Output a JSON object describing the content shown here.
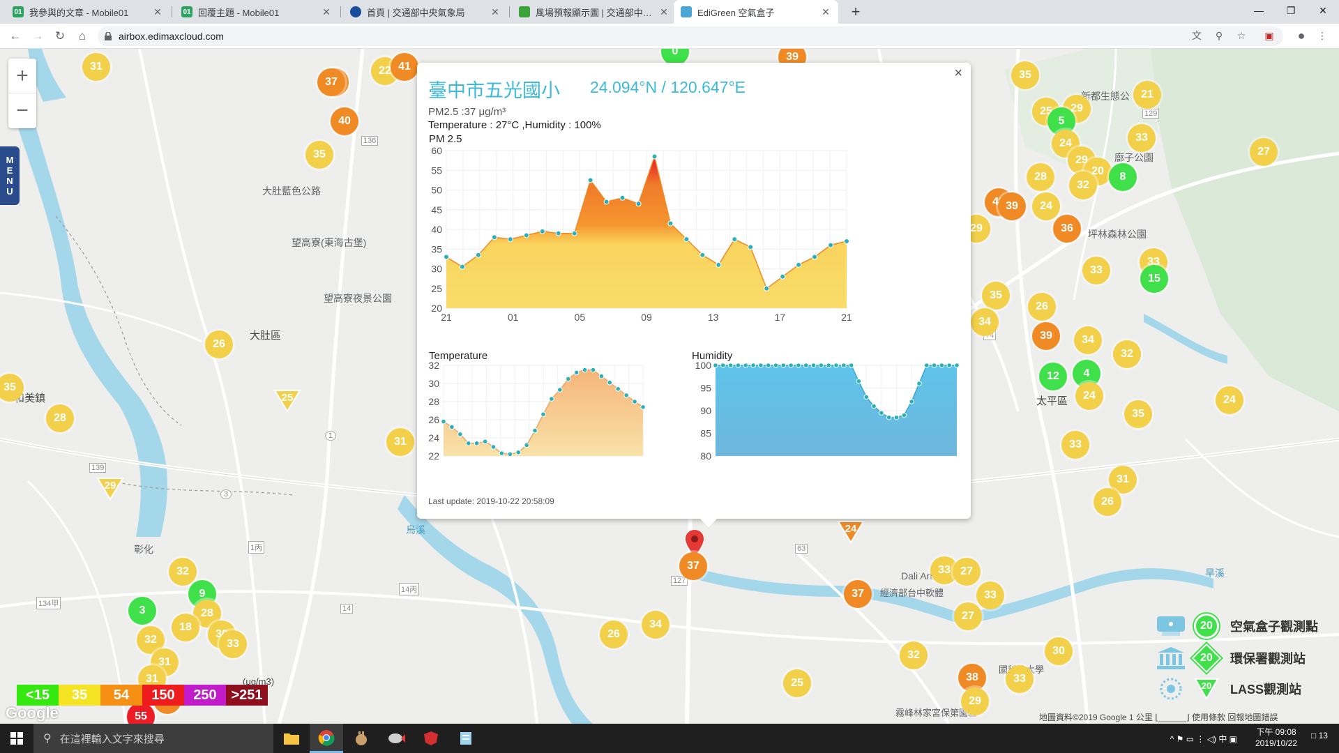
{
  "browser": {
    "tabs": [
      {
        "label": "我參與的文章 - Mobile01",
        "icon_color": "#2aa35f",
        "active": false
      },
      {
        "label": "回覆主題 - Mobile01",
        "icon_color": "#2aa35f",
        "active": false
      },
      {
        "label": "首頁 | 交通部中央氣象局",
        "icon_color": "#1a4c9c",
        "active": false
      },
      {
        "label": "風場預報顯示圖 | 交通部中央氣象局",
        "icon_color": "#3aa33a",
        "active": false
      },
      {
        "label": "EdiGreen 空氣盒子",
        "icon_color": "#4aa6d6",
        "active": true
      }
    ],
    "new_tab": "+",
    "url": "airbox.edimaxcloud.com",
    "window_controls": [
      "—",
      "❐",
      "✕"
    ]
  },
  "map": {
    "zoom_in": "+",
    "zoom_out": "−",
    "menu_label": [
      "M",
      "E",
      "N",
      "U"
    ],
    "place_labels": [
      "大肚藍色公路",
      "望高寮(東海古堡)",
      "望高寮夜景公園",
      "大肚區",
      "和美鎮",
      "太平區",
      "新都生態公",
      "廍子公園",
      "坪林森林公園",
      "彰化",
      "烏溪",
      "旱溪",
      "霧峰林家宮保第園區",
      "國科技大學",
      "Dali Art",
      "經濟部台中軟體"
    ],
    "road_labels": [
      "136",
      "129",
      "139",
      "134甲",
      "1",
      "3",
      "127",
      "63",
      "14",
      "74",
      "1丙",
      "14丙"
    ],
    "markers": [
      {
        "v": "31",
        "c": "y"
      },
      {
        "v": "37",
        "c": "o"
      },
      {
        "v": "22",
        "c": "y"
      },
      {
        "v": "41",
        "c": "o"
      },
      {
        "v": "40",
        "c": "o"
      },
      {
        "v": "35",
        "c": "y"
      },
      {
        "v": "0",
        "c": "g"
      },
      {
        "v": "39",
        "c": "o"
      },
      {
        "v": "35",
        "c": "y"
      },
      {
        "v": "21",
        "c": "y"
      },
      {
        "v": "25",
        "c": "y"
      },
      {
        "v": "29",
        "c": "y"
      },
      {
        "v": "5",
        "c": "g"
      },
      {
        "v": "33",
        "c": "y"
      },
      {
        "v": "27",
        "c": "y"
      },
      {
        "v": "24",
        "c": "y"
      },
      {
        "v": "29",
        "c": "y"
      },
      {
        "v": "28",
        "c": "y"
      },
      {
        "v": "20",
        "c": "y"
      },
      {
        "v": "8",
        "c": "g"
      },
      {
        "v": "32",
        "c": "y"
      },
      {
        "v": "42",
        "c": "o"
      },
      {
        "v": "39",
        "c": "o"
      },
      {
        "v": "24",
        "c": "y"
      },
      {
        "v": "36",
        "c": "o"
      },
      {
        "v": "29",
        "c": "y"
      },
      {
        "v": "33",
        "c": "y"
      },
      {
        "v": "33",
        "c": "y"
      },
      {
        "v": "15",
        "c": "g"
      },
      {
        "v": "35",
        "c": "y"
      },
      {
        "v": "26",
        "c": "y"
      },
      {
        "v": "34",
        "c": "y"
      },
      {
        "v": "39",
        "c": "o"
      },
      {
        "v": "34",
        "c": "y"
      },
      {
        "v": "32",
        "c": "y"
      },
      {
        "v": "12",
        "c": "g"
      },
      {
        "v": "4",
        "c": "g"
      },
      {
        "v": "24",
        "c": "y"
      },
      {
        "v": "24",
        "c": "y"
      },
      {
        "v": "35",
        "c": "y"
      },
      {
        "v": "33",
        "c": "y"
      },
      {
        "v": "31",
        "c": "y"
      },
      {
        "v": "26",
        "c": "y"
      },
      {
        "v": "26",
        "c": "y"
      },
      {
        "v": "35",
        "c": "y"
      },
      {
        "v": "28",
        "c": "y"
      },
      {
        "v": "31",
        "c": "y"
      },
      {
        "v": "32",
        "c": "y"
      },
      {
        "v": "9",
        "c": "g"
      },
      {
        "v": "3",
        "c": "g"
      },
      {
        "v": "28",
        "c": "y"
      },
      {
        "v": "18",
        "c": "y"
      },
      {
        "v": "30",
        "c": "y"
      },
      {
        "v": "32",
        "c": "y"
      },
      {
        "v": "31",
        "c": "y"
      },
      {
        "v": "33",
        "c": "y"
      },
      {
        "v": "31",
        "c": "y"
      },
      {
        "v": "27",
        "c": "o"
      },
      {
        "v": "55",
        "c": "r"
      },
      {
        "v": "37",
        "c": "o"
      },
      {
        "v": "34",
        "c": "y"
      },
      {
        "v": "26",
        "c": "y"
      },
      {
        "v": "37",
        "c": "o"
      },
      {
        "v": "33",
        "c": "y"
      },
      {
        "v": "27",
        "c": "y"
      },
      {
        "v": "33",
        "c": "y"
      },
      {
        "v": "27",
        "c": "y"
      },
      {
        "v": "32",
        "c": "y"
      },
      {
        "v": "33",
        "c": "y"
      },
      {
        "v": "30",
        "c": "y"
      },
      {
        "v": "38",
        "c": "o"
      },
      {
        "v": "29",
        "c": "y"
      },
      {
        "v": "25",
        "c": "y"
      },
      {
        "v": "31",
        "c": "y"
      }
    ],
    "tri_markers": [
      {
        "v": "25",
        "c": "y"
      },
      {
        "v": "29",
        "c": "y"
      },
      {
        "v": "24",
        "c": "o"
      }
    ],
    "pm_scale": [
      {
        "label": "<15",
        "color": "#35e80f"
      },
      {
        "label": "35",
        "color": "#f5e423"
      },
      {
        "label": "54",
        "color": "#f59015"
      },
      {
        "label": "150",
        "color": "#ee1c1c"
      },
      {
        "label": "250",
        "color": "#c21bc9"
      },
      {
        "label": ">251",
        "color": "#8f0e1d"
      }
    ],
    "scale_unit": "(μg/m3)",
    "google_logo": "Google",
    "legend": [
      {
        "value": "20",
        "label": "空氣盒子觀測點"
      },
      {
        "value": "20",
        "label": "環保署觀測站"
      },
      {
        "value": "20",
        "label": "LASS觀測站"
      }
    ],
    "attribution": "地圖資料©2019 Google   1 公里 ⌊______⌋   使用條款   回報地圖錯誤"
  },
  "popup": {
    "close": "×",
    "station_name": "臺中市五光國小",
    "coords": "24.094°N / 120.647°E",
    "pm_line": "PM2.5 :37 μg/m³",
    "temp_humidity_line": "Temperature : 27°C ,Humidity : 100%",
    "pm_title": "PM 2.5",
    "temp_title": "Temperature",
    "hum_title": "Humidity",
    "last_update": "Last update: 2019-10-22 20:58:09",
    "pin_value": "37"
  },
  "chart_data": [
    {
      "type": "area",
      "title": "PM 2.5",
      "x_tick_labels": [
        "21",
        "01",
        "05",
        "09",
        "13",
        "17",
        "21"
      ],
      "yticks": [
        20,
        25,
        30,
        35,
        40,
        45,
        50,
        55,
        60
      ],
      "ylim": [
        20,
        60
      ],
      "grid": true,
      "series": [
        {
          "values": [
            33,
            30.5,
            33.5,
            38,
            37.5,
            38.5,
            39.5,
            39,
            39,
            52.5,
            47,
            48,
            46.5,
            58.5,
            41.5,
            37.5,
            33.5,
            31,
            37.5,
            35.5,
            25,
            28,
            31,
            33,
            36,
            37
          ]
        }
      ]
    },
    {
      "type": "area",
      "title": "Temperature",
      "yticks": [
        22,
        24,
        26,
        28,
        30,
        32
      ],
      "ylim": [
        22,
        32
      ],
      "grid": true,
      "series": [
        {
          "values": [
            25.8,
            25.2,
            24.4,
            23.4,
            23.4,
            23.6,
            23,
            22.3,
            22.2,
            22.4,
            23.2,
            24.8,
            26.6,
            28.3,
            29.3,
            30.5,
            31.2,
            31.5,
            31.5,
            30.8,
            30.1,
            29.4,
            28.7,
            28,
            27.4
          ]
        }
      ]
    },
    {
      "type": "area",
      "title": "Humidity",
      "yticks": [
        80,
        85,
        90,
        95,
        100
      ],
      "ylim": [
        80,
        100
      ],
      "grid": true,
      "series": [
        {
          "values": [
            100,
            100,
            100,
            100,
            100,
            100,
            100,
            100,
            100,
            100,
            100,
            100,
            100,
            100,
            100,
            100,
            100,
            100,
            100,
            96.5,
            93,
            91,
            89.5,
            88.5,
            88.5,
            89,
            92,
            96,
            100,
            100,
            100,
            100,
            100
          ]
        }
      ]
    }
  ],
  "taskbar": {
    "search_placeholder": "在這裡輸入文字來搜尋",
    "tray": "^  ⚑  ▭  ⋮  ◁)  中  ▣",
    "time": "下午 09:08",
    "date": "2019/10/22",
    "notif_count": "13"
  }
}
